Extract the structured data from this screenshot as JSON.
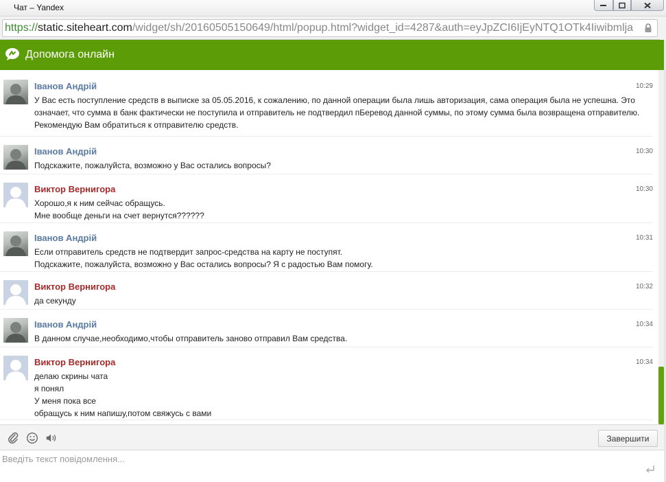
{
  "window": {
    "title": "Чат – Yandex"
  },
  "address": {
    "scheme": "https://",
    "host": "static.siteheart.com",
    "path": "/widget/sh/20160505150649/html/popup.html?widget_id=4287&auth=eyJpZCI6IjEyNTQ1OTk4Iiwibmlja"
  },
  "header": {
    "title": "Допомога онлайн"
  },
  "messages": [
    {
      "author": "Іванов Андрій",
      "role": "agent",
      "time": "10:29",
      "lines": [
        "У Вас есть поступление средств в выписке за 05.05.2016, к сожалению, по данной операции была лишь авторизация, сама операция была не успешна. Это означает, что сумма в банк фактически не поступила и отправитель не подтвердил пБеревод данной суммы, по этому сумма была возвращена отправителю. Рекомендую Вам обратиться к отправителю средств."
      ]
    },
    {
      "author": "Іванов Андрій",
      "role": "agent",
      "time": "10:30",
      "lines": [
        "Подскажите, пожалуйста, возможно у Вас остались вопросы?"
      ]
    },
    {
      "author": "Виктор Вернигора",
      "role": "client",
      "time": "10:30",
      "lines": [
        "Хорошо,я к ним сейчас обращусь.",
        "Мне вообще деньги на счет вернутся??????"
      ]
    },
    {
      "author": "Іванов Андрій",
      "role": "agent",
      "time": "10:31",
      "lines": [
        "Если отправитель средств не подтвердит запрос-средства на карту не поступят.",
        "Подскажите, пожалуйста, возможно у Вас остались вопросы? Я с радостью Вам помогу."
      ]
    },
    {
      "author": "Виктор Вернигора",
      "role": "client",
      "time": "10:32",
      "lines": [
        "да секунду"
      ]
    },
    {
      "author": "Іванов Андрій",
      "role": "agent",
      "time": "10:34",
      "lines": [
        "В данном случае,необходимо,чтобы отправитель заново отправил Вам средства."
      ]
    },
    {
      "author": "Виктор Вернигора",
      "role": "client",
      "time": "10:34",
      "lines": [
        "делаю скрины чата",
        "я понял",
        "У меня пока все",
        "обращусь к ним напишу,потом свяжусь с вами"
      ]
    }
  ],
  "toolbar": {
    "icons": [
      "paperclip-icon",
      "smiley-icon",
      "speaker-icon"
    ],
    "finish_label": "Завершити"
  },
  "input": {
    "placeholder": "Введіть текст повідомлення...",
    "value": ""
  },
  "colors": {
    "header_green": "#5c9c06",
    "agent_name": "#5b7ba3",
    "client_name": "#a52a2a",
    "scrollbar_thumb": "#63a10f"
  }
}
